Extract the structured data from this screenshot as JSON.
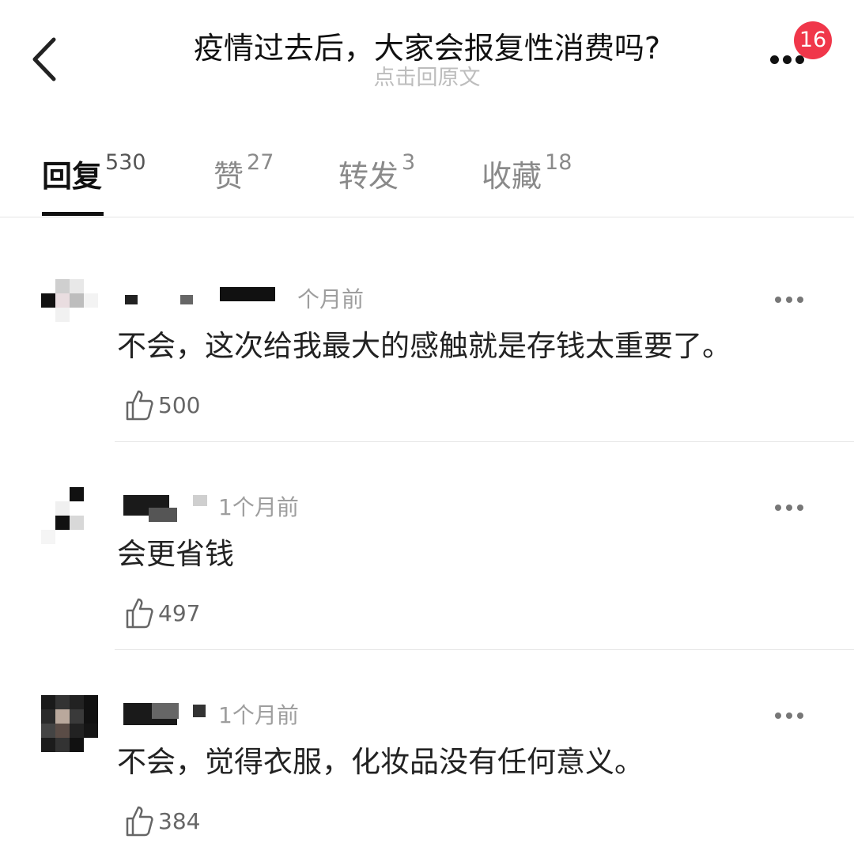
{
  "header": {
    "title": "疫情过去后，大家会报复性消费吗?",
    "subtitle": "点击回原文",
    "badge_count": "16",
    "back_icon": "chevron-left-icon",
    "more_icon": "more-dots-icon"
  },
  "tabs": [
    {
      "label": "回复",
      "count": "530",
      "active": true
    },
    {
      "label": "赞",
      "count": "27",
      "active": false
    },
    {
      "label": "转发",
      "count": "3",
      "active": false
    },
    {
      "label": "收藏",
      "count": "18",
      "active": false
    }
  ],
  "comments": [
    {
      "time": "个月前",
      "text": "不会，这次给我最大的感触就是存钱太重要了。",
      "likes": "500"
    },
    {
      "time": "1个月前",
      "text": "会更省钱",
      "likes": "497"
    },
    {
      "time": "1个月前",
      "text": "不会，觉得衣服，化妆品没有任何意义。",
      "likes": "384"
    }
  ],
  "colors": {
    "badge": "#f0374a",
    "accent_underline": "#111111",
    "muted": "#9e9e9e"
  }
}
